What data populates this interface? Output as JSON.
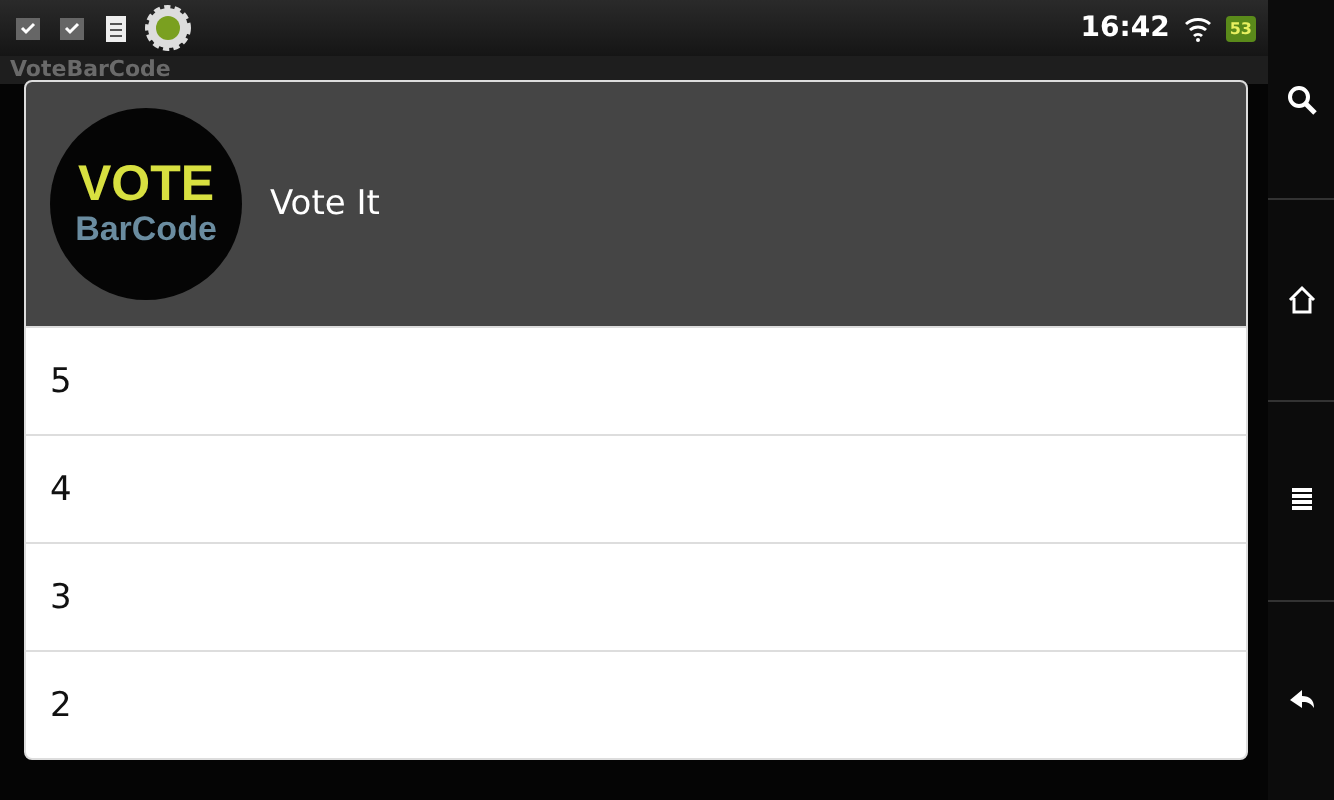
{
  "status_bar": {
    "time": "16:42",
    "battery": "53"
  },
  "app_title": "VoteBarCode",
  "dialog": {
    "logo": {
      "line_1": "VOTE",
      "line_2": "BarCode"
    },
    "title": "Vote It",
    "options": [
      {
        "label": "5"
      },
      {
        "label": "4"
      },
      {
        "label": "3"
      },
      {
        "label": "2"
      }
    ]
  }
}
